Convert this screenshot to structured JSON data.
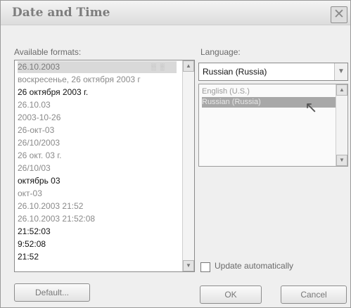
{
  "dialog": {
    "title": "Date and Time",
    "close_glyph": "✕"
  },
  "formats": {
    "label": "Available formats:",
    "items": [
      "26.10.2003",
      "воскресенье, 26 октября 2003 г",
      "26 октября 2003 г.",
      "26.10.03",
      "2003-10-26",
      "26-окт-03",
      "26/10/2003",
      "26 окт. 03 г.",
      "26/10/03",
      "октябрь 03",
      "окт-03",
      "26.10.2003 21:52",
      "26.10.2003 21:52:08",
      "21:52:03",
      "9:52:08",
      "21:52"
    ]
  },
  "language": {
    "label": "Language:",
    "selected": "Russian (Russia)",
    "options": [
      "English (U.S.)",
      "Russian (Russia)"
    ]
  },
  "update": {
    "label": "Update automatically",
    "checked": false
  },
  "buttons": {
    "default": "Default...",
    "ok": "OK",
    "cancel": "Cancel"
  }
}
